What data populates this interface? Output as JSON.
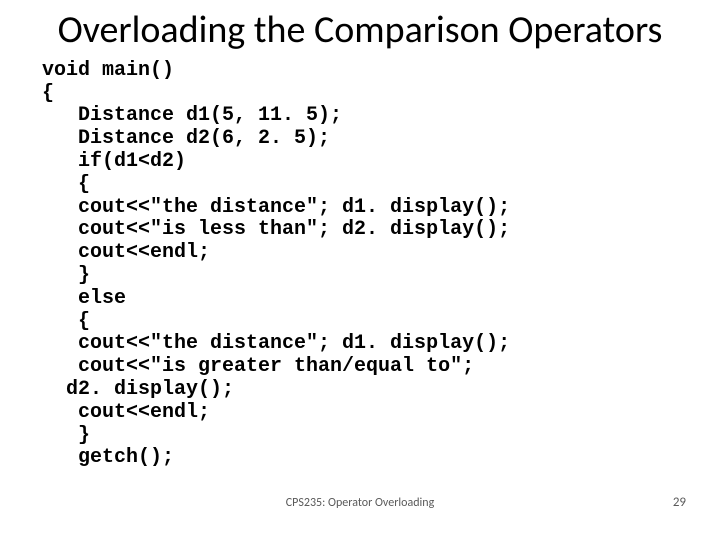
{
  "slide": {
    "title": "Overloading the Comparison Operators",
    "code": "void main()\n{\n   Distance d1(5, 11. 5);\n   Distance d2(6, 2. 5);\n   if(d1<d2)\n   {\n   cout<<\"the distance\"; d1. display();\n   cout<<\"is less than\"; d2. display();\n   cout<<endl;\n   }\n   else\n   {\n   cout<<\"the distance\"; d1. display();\n   cout<<\"is greater than/equal to\";\n  d2. display();\n   cout<<endl;\n   }\n   getch();",
    "footer_center": "CPS235: Operator Overloading",
    "page_number": "29"
  }
}
